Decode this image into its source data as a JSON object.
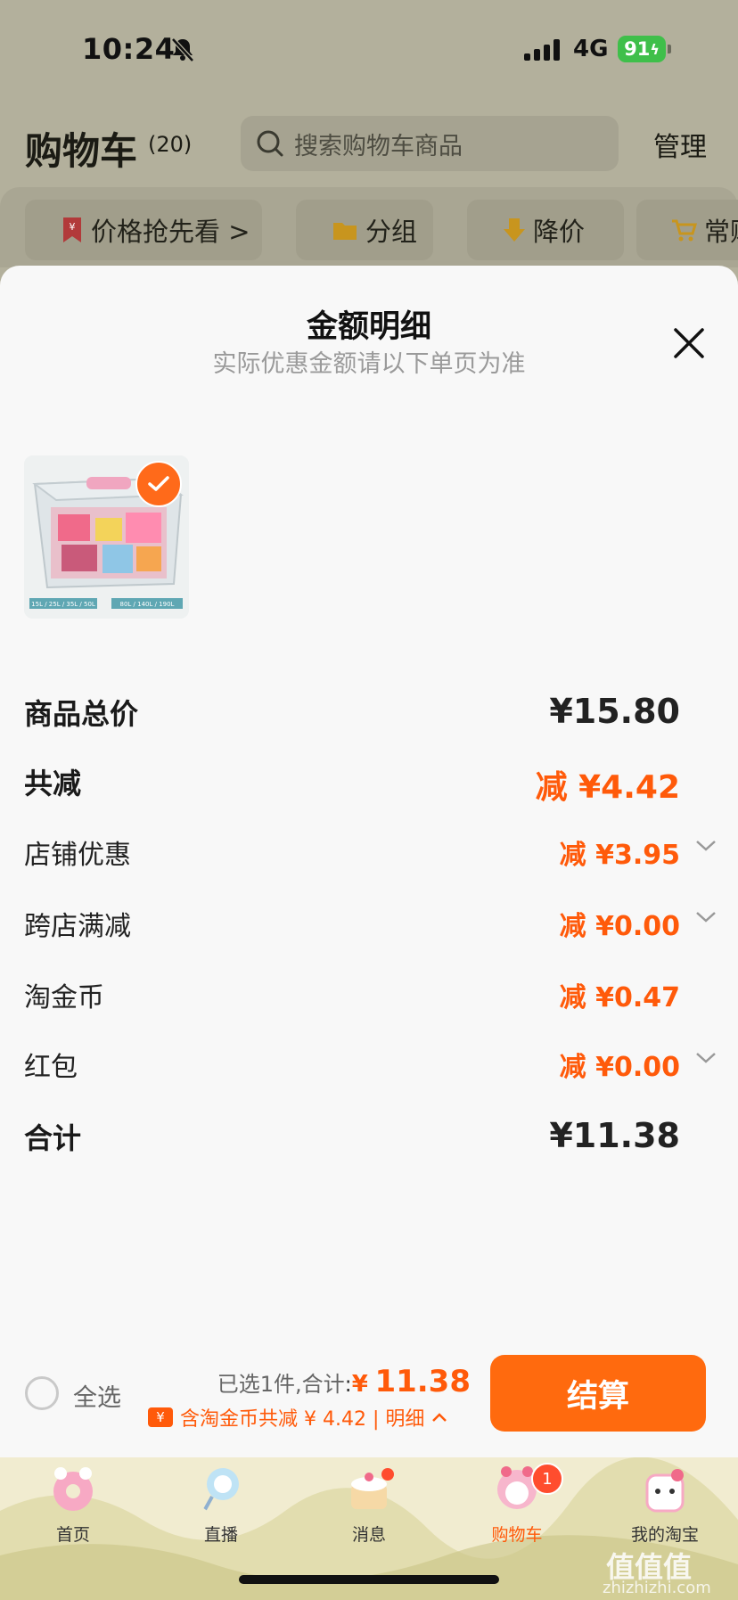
{
  "status_bar": {
    "time": "10:24",
    "network": "4G",
    "battery": "91"
  },
  "cart": {
    "title": "购物车",
    "count": "(20)",
    "search_placeholder": "搜索购物车商品",
    "manage": "管理",
    "chips": [
      "价格抢先看 >",
      "分组",
      "降价",
      "常购"
    ]
  },
  "sheet": {
    "title": "金额明细",
    "subtitle": "实际优惠金额请以下单页为准",
    "product": {
      "labels": [
        "15L / 25L / 35L / 50L",
        "80L / 140L / 190L"
      ]
    },
    "rows": [
      {
        "label": "商品总价",
        "value": "¥15.80"
      },
      {
        "label": "共减",
        "value": "减 ¥4.42"
      },
      {
        "label": "店铺优惠",
        "value": "减 ¥3.95"
      },
      {
        "label": "跨店满减",
        "value": "减 ¥0.00"
      },
      {
        "label": "淘金币",
        "value": "减 ¥0.47"
      },
      {
        "label": "红包",
        "value": "减 ¥0.00"
      },
      {
        "label": "合计",
        "value": "¥11.38"
      }
    ]
  },
  "checkout": {
    "select_all": "全选",
    "selected_text": "已选1件,合计",
    "colon": ":",
    "currency": "¥",
    "total": "11.38",
    "coin_note": "含淘金币共减 ¥ 4.42 | 明细",
    "pay_label": "结算"
  },
  "tabbar": {
    "tabs": [
      "首页",
      "直播",
      "消息",
      "购物车",
      "我的淘宝"
    ],
    "cart_badge": "1"
  },
  "watermark": {
    "text": "值值值",
    "sub": "zhizhizhi.com"
  },
  "colors": {
    "accent": "#ff5a0a",
    "pay_button": "#ff6a0e",
    "check": "#ff6a1a"
  }
}
